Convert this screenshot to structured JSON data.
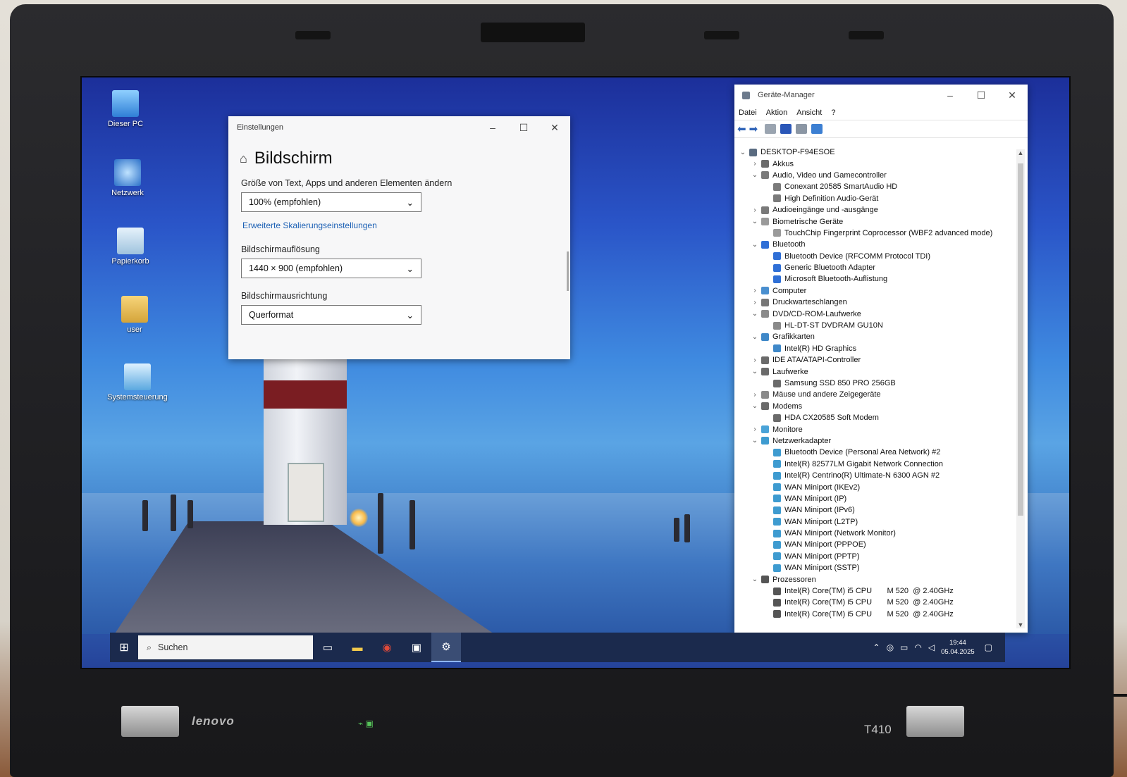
{
  "desktop_icons": [
    {
      "label": "Dieser PC",
      "icon": "this-pc-icon"
    },
    {
      "label": "Netzwerk",
      "icon": "network-icon"
    },
    {
      "label": "Papierkorb",
      "icon": "recycle-bin-icon"
    },
    {
      "label": "user",
      "icon": "user-folder-icon"
    },
    {
      "label": "Systemsteuerung",
      "icon": "control-panel-icon"
    }
  ],
  "settings": {
    "window_title": "Einstellungen",
    "page_title": "Bildschirm",
    "scale_label": "Größe von Text, Apps und anderen Elementen ändern",
    "scale_value": "100% (empfohlen)",
    "advanced_link": "Erweiterte Skalierungseinstellungen",
    "resolution_label": "Bildschirmauflösung",
    "resolution_value": "1440 × 900 (empfohlen)",
    "orientation_label": "Bildschirmausrichtung",
    "orientation_value": "Querformat"
  },
  "device_manager": {
    "window_title": "Geräte-Manager",
    "menu": [
      "Datei",
      "Aktion",
      "Ansicht",
      "?"
    ],
    "tree": [
      {
        "label": "DESKTOP-F94ESOE",
        "level": 0,
        "exp": "open",
        "color": "#5a6b80"
      },
      {
        "label": "Akkus",
        "level": 1,
        "exp": "closed",
        "color": "#6b6b6b"
      },
      {
        "label": "Audio, Video und Gamecontroller",
        "level": 1,
        "exp": "open",
        "color": "#7a7a7a"
      },
      {
        "label": "Conexant 20585 SmartAudio HD",
        "level": 2,
        "exp": "none",
        "color": "#7a7a7a"
      },
      {
        "label": "High Definition Audio-Gerät",
        "level": 2,
        "exp": "none",
        "color": "#7a7a7a"
      },
      {
        "label": "Audioeingänge und -ausgänge",
        "level": 1,
        "exp": "closed",
        "color": "#7a7a7a"
      },
      {
        "label": "Biometrische Geräte",
        "level": 1,
        "exp": "open",
        "color": "#9a9a9a"
      },
      {
        "label": "TouchChip Fingerprint Coprocessor (WBF2 advanced mode)",
        "level": 2,
        "exp": "none",
        "color": "#9a9a9a"
      },
      {
        "label": "Bluetooth",
        "level": 1,
        "exp": "open",
        "color": "#2f6fd6"
      },
      {
        "label": "Bluetooth Device (RFCOMM Protocol TDI)",
        "level": 2,
        "exp": "none",
        "color": "#2f6fd6"
      },
      {
        "label": "Generic Bluetooth Adapter",
        "level": 2,
        "exp": "none",
        "color": "#2f6fd6"
      },
      {
        "label": "Microsoft Bluetooth-Auflistung",
        "level": 2,
        "exp": "none",
        "color": "#2f6fd6"
      },
      {
        "label": "Computer",
        "level": 1,
        "exp": "closed",
        "color": "#4a8fcf"
      },
      {
        "label": "Druckwarteschlangen",
        "level": 1,
        "exp": "closed",
        "color": "#777777"
      },
      {
        "label": "DVD/CD-ROM-Laufwerke",
        "level": 1,
        "exp": "open",
        "color": "#8a8a8a"
      },
      {
        "label": "HL-DT-ST DVDRAM GU10N",
        "level": 2,
        "exp": "none",
        "color": "#8a8a8a"
      },
      {
        "label": "Grafikkarten",
        "level": 1,
        "exp": "open",
        "color": "#3f88c8"
      },
      {
        "label": "Intel(R) HD Graphics",
        "level": 2,
        "exp": "none",
        "color": "#3f88c8"
      },
      {
        "label": "IDE ATA/ATAPI-Controller",
        "level": 1,
        "exp": "closed",
        "color": "#6a6a6a"
      },
      {
        "label": "Laufwerke",
        "level": 1,
        "exp": "open",
        "color": "#6a6a6a"
      },
      {
        "label": "Samsung SSD 850 PRO 256GB",
        "level": 2,
        "exp": "none",
        "color": "#6a6a6a"
      },
      {
        "label": "Mäuse und andere Zeigegeräte",
        "level": 1,
        "exp": "closed",
        "color": "#8a8a8a"
      },
      {
        "label": "Modems",
        "level": 1,
        "exp": "open",
        "color": "#6a6a6a"
      },
      {
        "label": "HDA CX20585 Soft Modem",
        "level": 2,
        "exp": "none",
        "color": "#6a6a6a"
      },
      {
        "label": "Monitore",
        "level": 1,
        "exp": "closed",
        "color": "#4aa3d8"
      },
      {
        "label": "Netzwerkadapter",
        "level": 1,
        "exp": "open",
        "color": "#3e9bd0"
      },
      {
        "label": "Bluetooth Device (Personal Area Network) #2",
        "level": 2,
        "exp": "none",
        "color": "#3e9bd0"
      },
      {
        "label": "Intel(R) 82577LM Gigabit Network Connection",
        "level": 2,
        "exp": "none",
        "color": "#3e9bd0"
      },
      {
        "label": "Intel(R) Centrino(R) Ultimate-N 6300 AGN #2",
        "level": 2,
        "exp": "none",
        "color": "#3e9bd0"
      },
      {
        "label": "WAN Miniport (IKEv2)",
        "level": 2,
        "exp": "none",
        "color": "#3e9bd0"
      },
      {
        "label": "WAN Miniport (IP)",
        "level": 2,
        "exp": "none",
        "color": "#3e9bd0"
      },
      {
        "label": "WAN Miniport (IPv6)",
        "level": 2,
        "exp": "none",
        "color": "#3e9bd0"
      },
      {
        "label": "WAN Miniport (L2TP)",
        "level": 2,
        "exp": "none",
        "color": "#3e9bd0"
      },
      {
        "label": "WAN Miniport (Network Monitor)",
        "level": 2,
        "exp": "none",
        "color": "#3e9bd0"
      },
      {
        "label": "WAN Miniport (PPPOE)",
        "level": 2,
        "exp": "none",
        "color": "#3e9bd0"
      },
      {
        "label": "WAN Miniport (PPTP)",
        "level": 2,
        "exp": "none",
        "color": "#3e9bd0"
      },
      {
        "label": "WAN Miniport (SSTP)",
        "level": 2,
        "exp": "none",
        "color": "#3e9bd0"
      },
      {
        "label": "Prozessoren",
        "level": 1,
        "exp": "open",
        "color": "#555555"
      },
      {
        "label": "Intel(R) Core(TM) i5 CPU       M 520  @ 2.40GHz",
        "level": 2,
        "exp": "none",
        "color": "#555555"
      },
      {
        "label": "Intel(R) Core(TM) i5 CPU       M 520  @ 2.40GHz",
        "level": 2,
        "exp": "none",
        "color": "#555555"
      },
      {
        "label": "Intel(R) Core(TM) i5 CPU       M 520  @ 2.40GHz",
        "level": 2,
        "exp": "none",
        "color": "#555555"
      }
    ]
  },
  "taskbar": {
    "search_placeholder": "Suchen",
    "time": "19:44",
    "date": "05.04.2025"
  },
  "laptop": {
    "brand": "lenovo",
    "model": "T410"
  }
}
